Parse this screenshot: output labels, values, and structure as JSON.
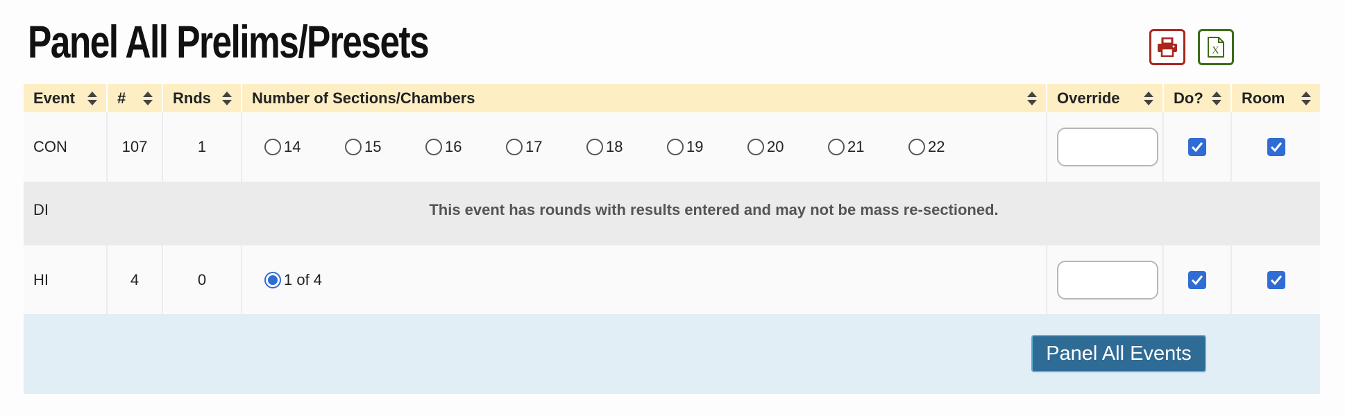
{
  "page": {
    "title": "Panel All Prelims/Presets"
  },
  "toolbar": {
    "print_icon": "printer-icon",
    "excel_icon": "excel-file-icon",
    "excel_glyph": "X"
  },
  "table": {
    "headers": [
      "Event",
      "#",
      "Rnds",
      "Number of Sections/Chambers",
      "Override",
      "Do?",
      "Room"
    ],
    "rows": [
      {
        "event": "CON",
        "count": "107",
        "rounds": "1",
        "options": [
          "14",
          "15",
          "16",
          "17",
          "18",
          "19",
          "20",
          "21",
          "22"
        ],
        "selected": null,
        "override": "",
        "do": true,
        "room": true
      },
      {
        "event": "DI",
        "note": "This event has rounds with results entered and may not be mass re-sectioned."
      },
      {
        "event": "HI",
        "count": "4",
        "rounds": "0",
        "options": [
          "1 of 4"
        ],
        "selected": "1 of 4",
        "override": "",
        "do": true,
        "room": true
      }
    ]
  },
  "footer": {
    "panel_button_label": "Panel All Events"
  },
  "colors": {
    "header_bg": "#fdeec4",
    "footer_bg": "#e1eef6",
    "primary_button": "#2e6b95",
    "print_red": "#a8261d",
    "excel_green": "#3f6b1a",
    "check_blue": "#2f6cd4"
  }
}
